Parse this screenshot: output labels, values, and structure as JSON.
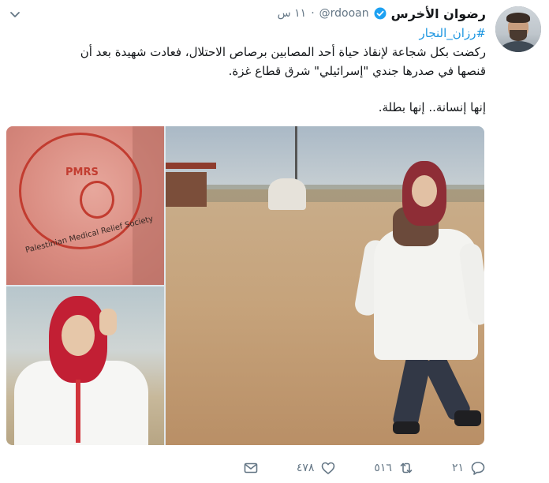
{
  "user": {
    "name": "رضوان الأخرس",
    "handle": "@rdooan",
    "time": "١١ س"
  },
  "tweet": {
    "hashtag": "#رزان_النجار",
    "line1": "ركضت بكل شجاعة لإنقاذ حياة أحد المصابين برصاص الاحتلال، فعادت شهيدة بعد أن",
    "line2": "قنصها في صدرها جندي \"إسرائيلي\" شرق قطاع غزة.",
    "line3": "إنها إنسانة.. إنها بطلة."
  },
  "media": {
    "patch_text": "PMRS",
    "patch_arc": "Palestinian Medical Relief Society"
  },
  "actions": {
    "replies": "٢١",
    "retweets": "٥١٦",
    "likes": "٤٧٨"
  },
  "colors": {
    "link": "#1b95e0",
    "muted": "#657786",
    "verified": "#1da1f2"
  }
}
